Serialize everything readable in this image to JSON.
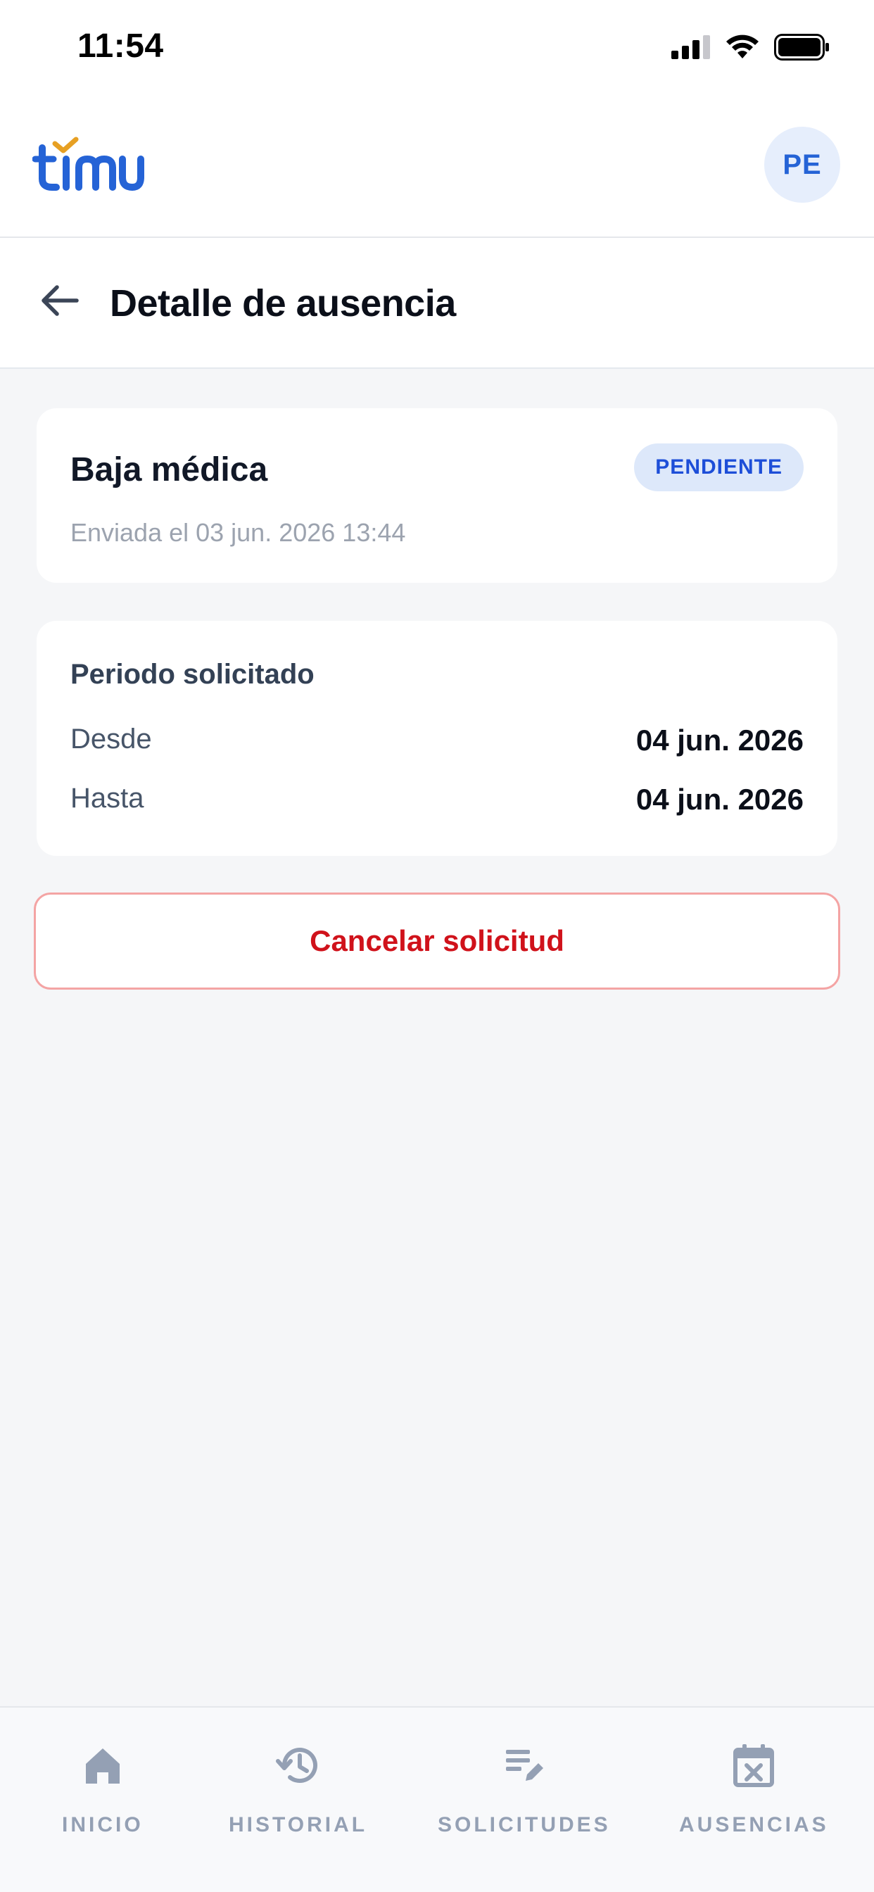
{
  "status_bar": {
    "time": "11:54"
  },
  "app": {
    "logo_text": "timu",
    "avatar_initials": "PE",
    "brand_color": "#2563d6",
    "accent_color": "#e7a023"
  },
  "page": {
    "title": "Detalle de ausencia"
  },
  "absence": {
    "type": "Baja médica",
    "status": "PENDIENTE",
    "sent": "Enviada el 03 jun. 2026 13:44"
  },
  "period": {
    "title": "Periodo solicitado",
    "from_label": "Desde",
    "from_value": "04 jun. 2026",
    "to_label": "Hasta",
    "to_value": "04 jun. 2026"
  },
  "actions": {
    "cancel_label": "Cancelar solicitud",
    "cancel_color": "#d0121b"
  },
  "nav": {
    "items": [
      {
        "label": "INICIO",
        "icon": "home-icon"
      },
      {
        "label": "HISTORIAL",
        "icon": "history-icon"
      },
      {
        "label": "SOLICITUDES",
        "icon": "edit-list-icon"
      },
      {
        "label": "AUSENCIAS",
        "icon": "calendar-x-icon"
      }
    ]
  }
}
